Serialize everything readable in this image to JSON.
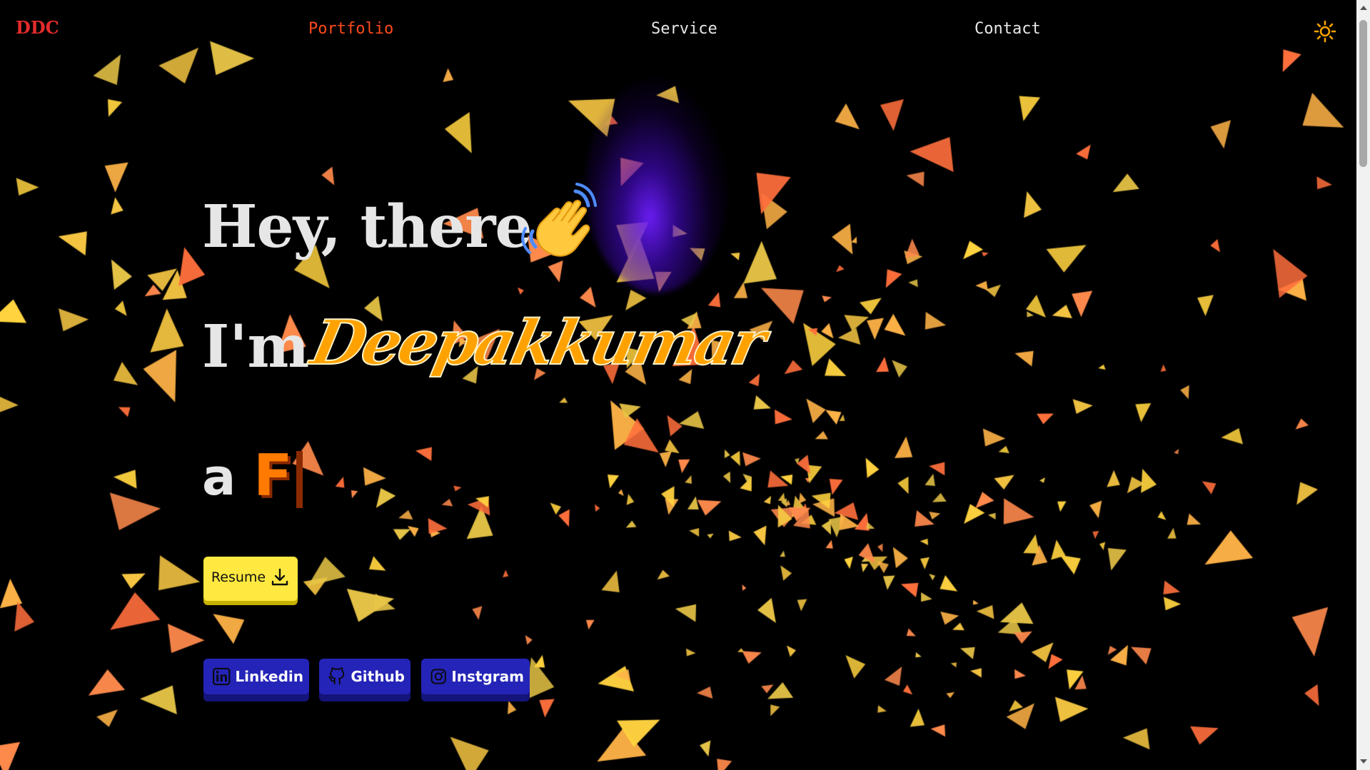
{
  "nav": {
    "logo": "DDC",
    "links": [
      "Portfolio",
      "Service",
      "Contact"
    ],
    "active": "Portfolio",
    "theme_icon": "sun-icon"
  },
  "hero": {
    "greeting": "Hey, there",
    "wave_icon": "waving-hand-icon",
    "im": "I'm",
    "name": "Deepakkumar",
    "a": "a",
    "typed": "F"
  },
  "resume": {
    "label": "Resume",
    "icon": "download-icon"
  },
  "socials": [
    {
      "label": "Linkedin",
      "icon": "linkedin-icon"
    },
    {
      "label": "Github",
      "icon": "github-icon"
    },
    {
      "label": "Instgram",
      "icon": "instagram-icon"
    }
  ],
  "colors": {
    "background": "#000000",
    "accent_nav": "#ff4a1c",
    "logo": "#e52b2b",
    "name": "#ffa200",
    "resume_button": "#ffe940",
    "social_button": "#2424b8"
  }
}
